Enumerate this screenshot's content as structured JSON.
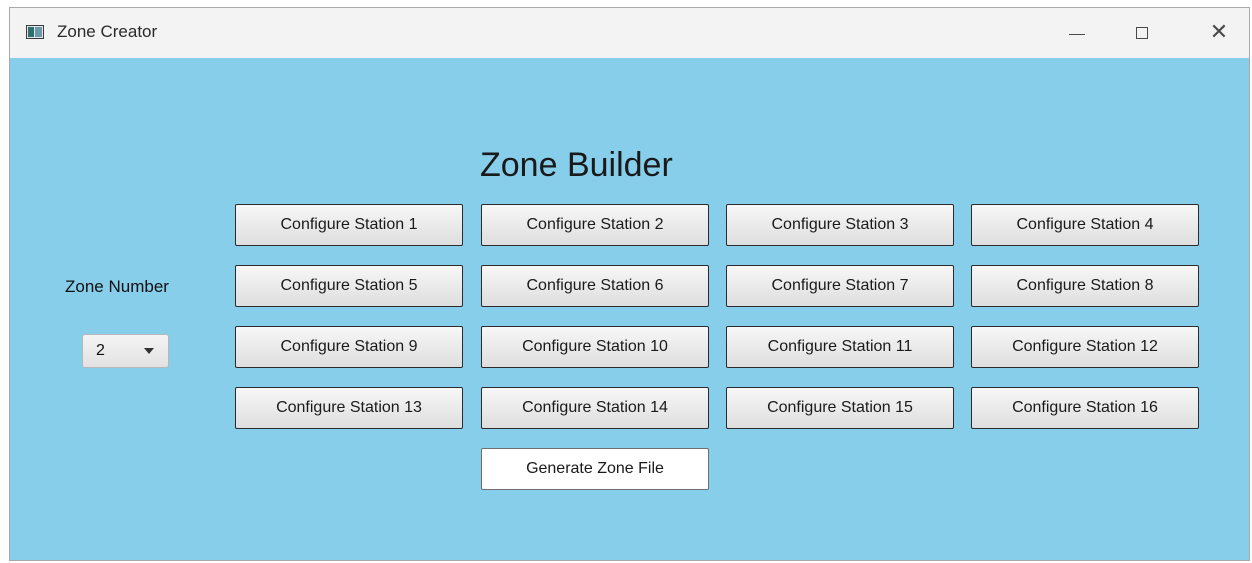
{
  "window": {
    "title": "Zone Creator"
  },
  "window_controls": {
    "minimize_icon": "minimize-icon",
    "maximize_icon": "maximize-icon",
    "close_icon": "close-icon"
  },
  "main": {
    "heading": "Zone Builder",
    "zone_label": "Zone Number",
    "zone_select": {
      "value": "2"
    },
    "station_buttons": [
      "Configure Station 1",
      "Configure Station 2",
      "Configure Station 3",
      "Configure Station 4",
      "Configure Station 5",
      "Configure Station 6",
      "Configure Station 7",
      "Configure Station 8",
      "Configure Station 9",
      "Configure Station 10",
      "Configure Station 11",
      "Configure Station 12",
      "Configure Station 13",
      "Configure Station 14",
      "Configure Station 15",
      "Configure Station 16"
    ],
    "generate_button": "Generate Zone File"
  },
  "colors": {
    "background": "#87ceeb",
    "titlebar": "#f3f3f3"
  }
}
